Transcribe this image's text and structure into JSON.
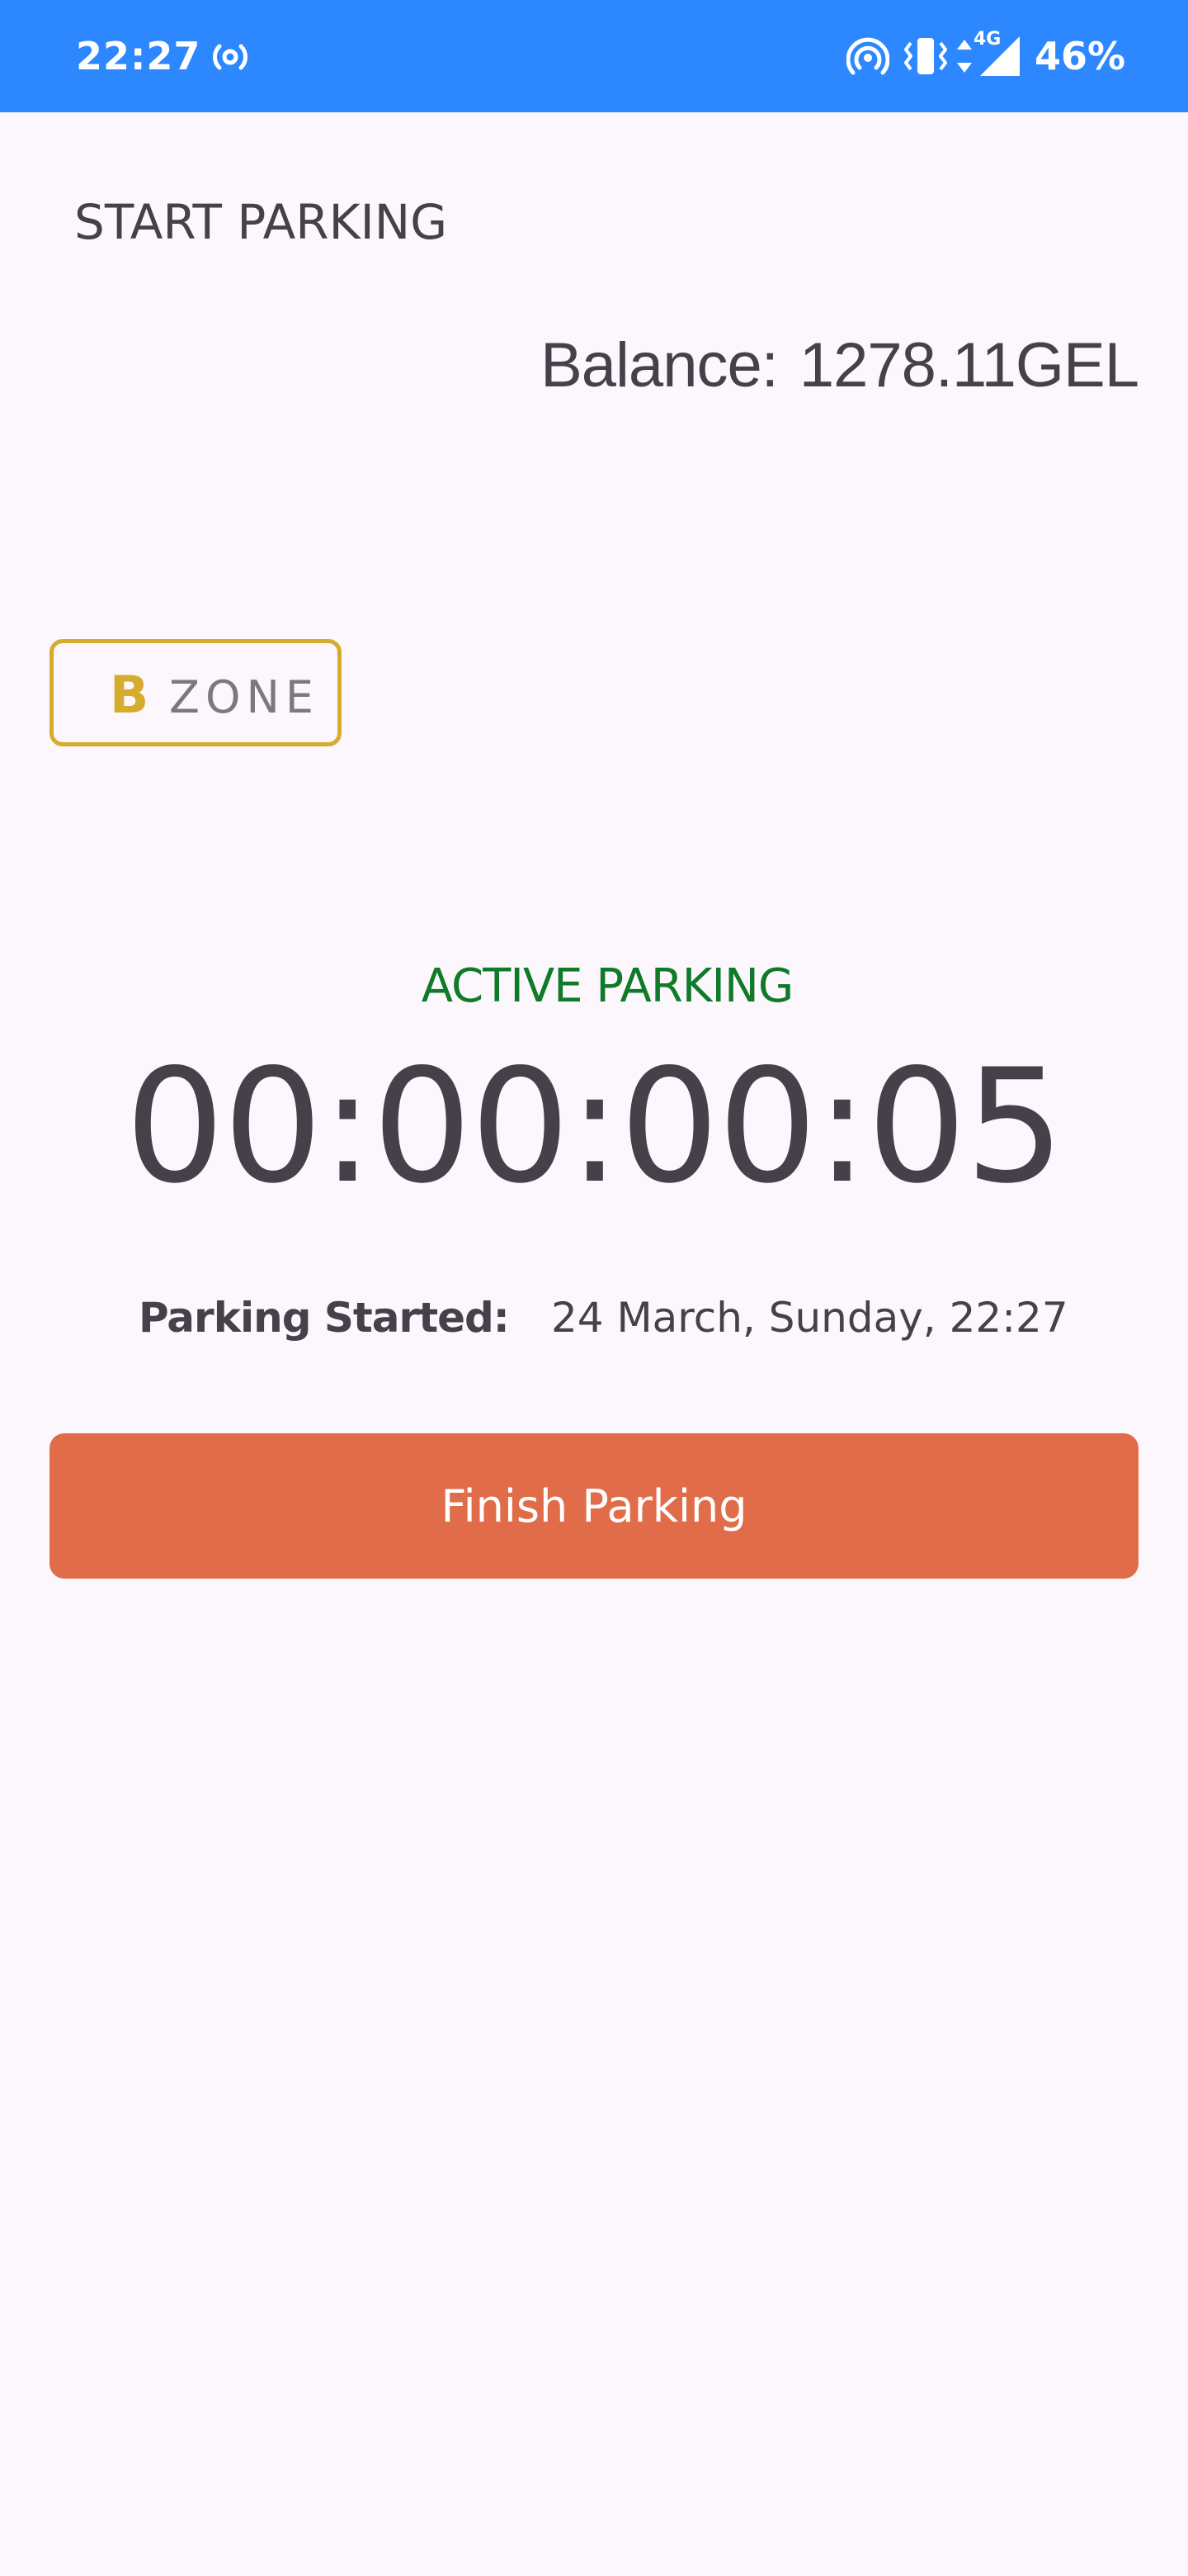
{
  "status_bar": {
    "time": "22:27",
    "network": "4G",
    "battery": "46%",
    "color": "#2d88ff",
    "icons": [
      "radio-broadcast-icon",
      "hotspot-icon",
      "vibrate-icon",
      "data-arrows-icon",
      "signal-icon"
    ]
  },
  "header": {
    "title": "START PARKING"
  },
  "balance": {
    "label": "Balance:",
    "value": "1278.11GEL"
  },
  "zone": {
    "letter": "B",
    "label": "ZONE",
    "color": "#d6ac2e"
  },
  "session": {
    "status": "ACTIVE PARKING",
    "status_color": "#0f7a28",
    "timer": "00:00:00:05",
    "started_label": "Parking Started:",
    "started_value": "24 March, Sunday, 22:27"
  },
  "actions": {
    "finish_label": "Finish Parking",
    "finish_color": "#e06c49"
  }
}
